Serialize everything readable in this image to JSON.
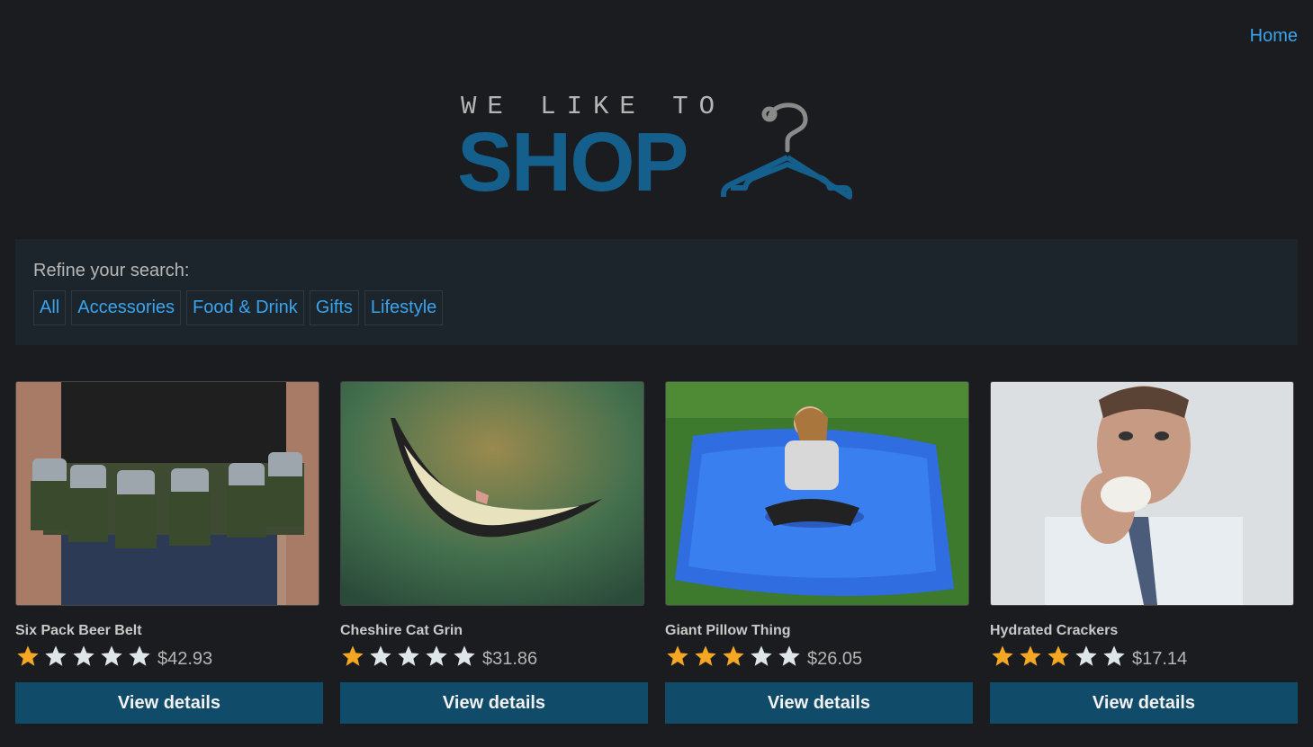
{
  "nav": {
    "home_label": "Home"
  },
  "logo": {
    "tagline": "WE LIKE TO",
    "word": "SHOP",
    "color": "#145f8c"
  },
  "search": {
    "label": "Refine your search:",
    "filters": [
      "All",
      "Accessories",
      "Food & Drink",
      "Gifts",
      "Lifestyle"
    ]
  },
  "products": [
    {
      "name": "Six Pack Beer Belt",
      "rating": 1,
      "price": "$42.93",
      "button": "View details"
    },
    {
      "name": "Cheshire Cat Grin",
      "rating": 1,
      "price": "$31.86",
      "button": "View details"
    },
    {
      "name": "Giant Pillow Thing",
      "rating": 3,
      "price": "$26.05",
      "button": "View details"
    },
    {
      "name": "Hydrated Crackers",
      "rating": 3,
      "price": "$17.14",
      "button": "View details"
    }
  ],
  "colors": {
    "link": "#3aa4ef",
    "button_bg": "#104b69",
    "star_filled": "#f5a623",
    "star_empty": "#dfe6e9"
  }
}
